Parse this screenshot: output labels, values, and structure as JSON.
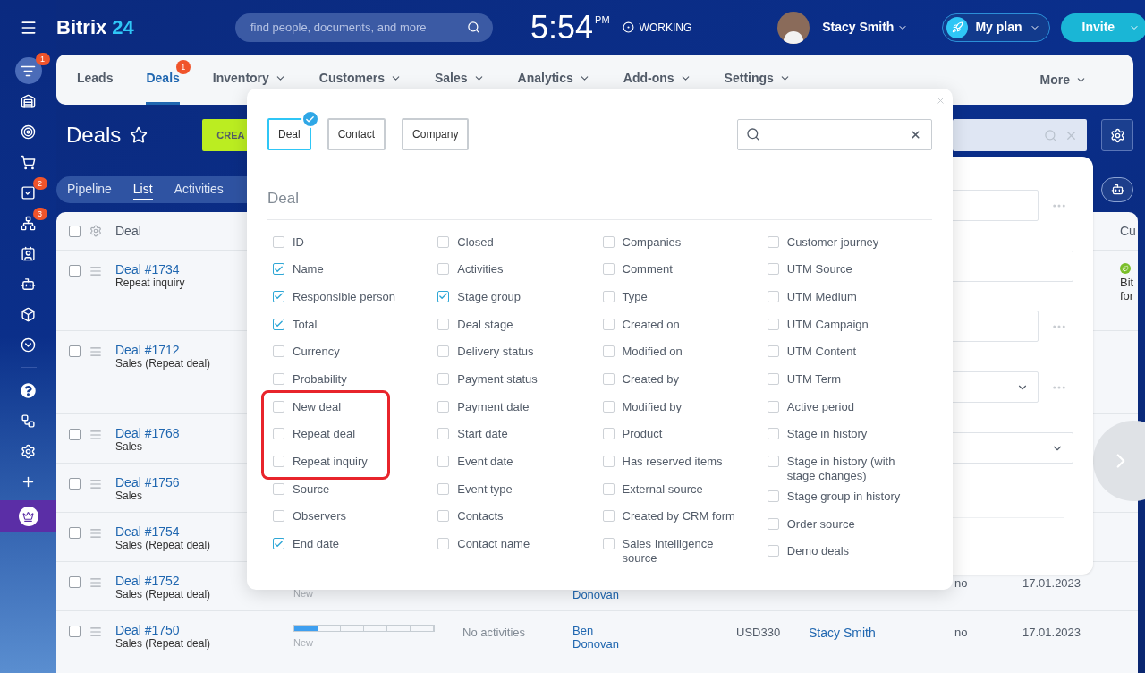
{
  "header": {
    "logo_name": "Bitrix",
    "logo_number": "24",
    "search": {
      "placeholder": "find people, documents, and more"
    },
    "time": "5:54",
    "time_suffix": "PM",
    "work_status": "WORKING",
    "user_name": "Stacy Smith",
    "plan_button": "My plan",
    "invite_button": "Invite"
  },
  "sidebar": {
    "items": [
      {
        "kind": "filter",
        "selected": true,
        "badge": "1"
      },
      {
        "kind": "warehouse",
        "selected": false
      },
      {
        "kind": "target",
        "selected": false
      },
      {
        "kind": "cart",
        "selected": false
      },
      {
        "kind": "tasks",
        "selected": false,
        "badge": "2"
      },
      {
        "kind": "network",
        "selected": false,
        "badge": "3"
      },
      {
        "kind": "contact",
        "selected": false
      },
      {
        "kind": "robot",
        "selected": false
      },
      {
        "kind": "box",
        "selected": false
      },
      {
        "kind": "more",
        "selected": false
      },
      {
        "kind": "help",
        "selected": false
      },
      {
        "kind": "sitemap",
        "selected": false
      },
      {
        "kind": "settings",
        "selected": false
      },
      {
        "kind": "add",
        "selected": false
      },
      {
        "kind": "crown",
        "selected": false
      }
    ]
  },
  "nav": {
    "items": [
      {
        "label": "Leads",
        "selected": false,
        "dropdown": false
      },
      {
        "label": "Deals",
        "selected": true,
        "dropdown": false,
        "badge": "1"
      },
      {
        "label": "Inventory",
        "selected": false,
        "dropdown": true
      },
      {
        "label": "Customers",
        "selected": false,
        "dropdown": true
      },
      {
        "label": "Sales",
        "selected": false,
        "dropdown": true
      },
      {
        "label": "Analytics",
        "selected": false,
        "dropdown": true
      },
      {
        "label": "Add-ons",
        "selected": false,
        "dropdown": true
      },
      {
        "label": "Settings",
        "selected": false,
        "dropdown": true
      }
    ],
    "more": "More"
  },
  "page": {
    "title": "Deals",
    "create_button": "CREA",
    "views": [
      {
        "label": "Pipeline",
        "selected": false
      },
      {
        "label": "List",
        "selected": true
      },
      {
        "label": "Activities",
        "selected": false
      }
    ]
  },
  "table": {
    "select_all_checked": false,
    "columns": {
      "deal": "Deal",
      "column_last": "Cu"
    },
    "rows": [
      {
        "title": "Deal #1734",
        "subtitle": "Repeat inquiry",
        "checked": false,
        "last_cell": [
          "Bit",
          "for"
        ]
      },
      {
        "title": "Deal #1712",
        "subtitle": "Sales (Repeat deal)",
        "checked": false
      },
      {
        "title": "Deal #1768",
        "subtitle": "Sales",
        "checked": false
      },
      {
        "title": "Deal #1756",
        "subtitle": "Sales",
        "checked": false
      },
      {
        "title": "Deal #1754",
        "subtitle": "Sales (Repeat deal)",
        "checked": false
      },
      {
        "title": "Deal #1752",
        "subtitle": "Sales (Repeat deal)",
        "checked": false,
        "stage": "New",
        "contact": "Donovan",
        "column_9": "no",
        "date": "17.01.2023"
      },
      {
        "title": "Deal #1750",
        "subtitle": "Sales (Repeat deal)",
        "checked": false,
        "stage": "New",
        "level": 0.17,
        "activity": "No activities",
        "contact": "Ben Donovan",
        "amount": "USD330",
        "responsible": "Stacy Smith",
        "column_9": "no",
        "date": "17.01.2023"
      }
    ]
  },
  "field_picker": {
    "entities": [
      {
        "label": "Deal",
        "selected": true
      },
      {
        "label": "Contact",
        "selected": false
      },
      {
        "label": "Company",
        "selected": false
      }
    ],
    "section": "Deal",
    "columns": [
      [
        {
          "kind": "field",
          "label": "ID",
          "checked": false
        },
        {
          "kind": "field",
          "label": "Name",
          "checked": true
        },
        {
          "kind": "field",
          "label": "Responsible person",
          "checked": true
        },
        {
          "kind": "field",
          "label": "Total",
          "checked": true
        },
        {
          "kind": "field",
          "label": "Currency",
          "checked": false
        },
        {
          "kind": "field",
          "label": "Probability",
          "checked": false
        },
        {
          "kind": "highlight_group",
          "items": [
            {
              "label": "New deal",
              "checked": false
            },
            {
              "label": "Repeat deal",
              "checked": false
            },
            {
              "label": "Repeat inquiry",
              "checked": false
            }
          ]
        },
        {
          "kind": "field",
          "label": "Source",
          "checked": false
        },
        {
          "kind": "field",
          "label": "Observers",
          "checked": false
        },
        {
          "kind": "field",
          "label": "End date",
          "checked": true
        }
      ],
      [
        {
          "label": "Closed",
          "checked": false
        },
        {
          "label": "Activities",
          "checked": false
        },
        {
          "label": "Stage group",
          "checked": true
        },
        {
          "label": "Deal stage",
          "checked": false
        },
        {
          "label": "Delivery status",
          "checked": false
        },
        {
          "label": "Payment status",
          "checked": false
        },
        {
          "label": "Payment date",
          "checked": false
        },
        {
          "label": "Start date",
          "checked": false
        },
        {
          "label": "Event date",
          "checked": false
        },
        {
          "label": "Event type",
          "checked": false
        },
        {
          "label": "Contacts",
          "checked": false
        },
        {
          "label": "Contact name",
          "checked": false
        }
      ],
      [
        {
          "label": "Companies",
          "checked": false
        },
        {
          "label": "Comment",
          "checked": false
        },
        {
          "label": "Type",
          "checked": false
        },
        {
          "label": "Created on",
          "checked": false
        },
        {
          "label": "Modified on",
          "checked": false
        },
        {
          "label": "Created by",
          "checked": false
        },
        {
          "label": "Modified by",
          "checked": false
        },
        {
          "label": "Product",
          "checked": false
        },
        {
          "label": "Has reserved items",
          "checked": false
        },
        {
          "label": "External source",
          "checked": false
        },
        {
          "label": "Created by CRM form",
          "checked": false
        },
        {
          "label": "Sales Intelligence source",
          "checked": false
        }
      ],
      [
        {
          "label": "Customer journey",
          "checked": false
        },
        {
          "label": "UTM Source",
          "checked": false
        },
        {
          "label": "UTM Medium",
          "checked": false
        },
        {
          "label": "UTM Campaign",
          "checked": false
        },
        {
          "label": "UTM Content",
          "checked": false
        },
        {
          "label": "UTM Term",
          "checked": false
        },
        {
          "label": "Active period",
          "checked": false
        },
        {
          "label": "Stage in history",
          "checked": false
        },
        {
          "label": "Stage in history (with stage changes)",
          "checked": false
        },
        {
          "label": "Stage group in history",
          "checked": false
        },
        {
          "label": "Order source",
          "checked": false
        },
        {
          "label": "Demo deals",
          "checked": false
        }
      ]
    ]
  }
}
